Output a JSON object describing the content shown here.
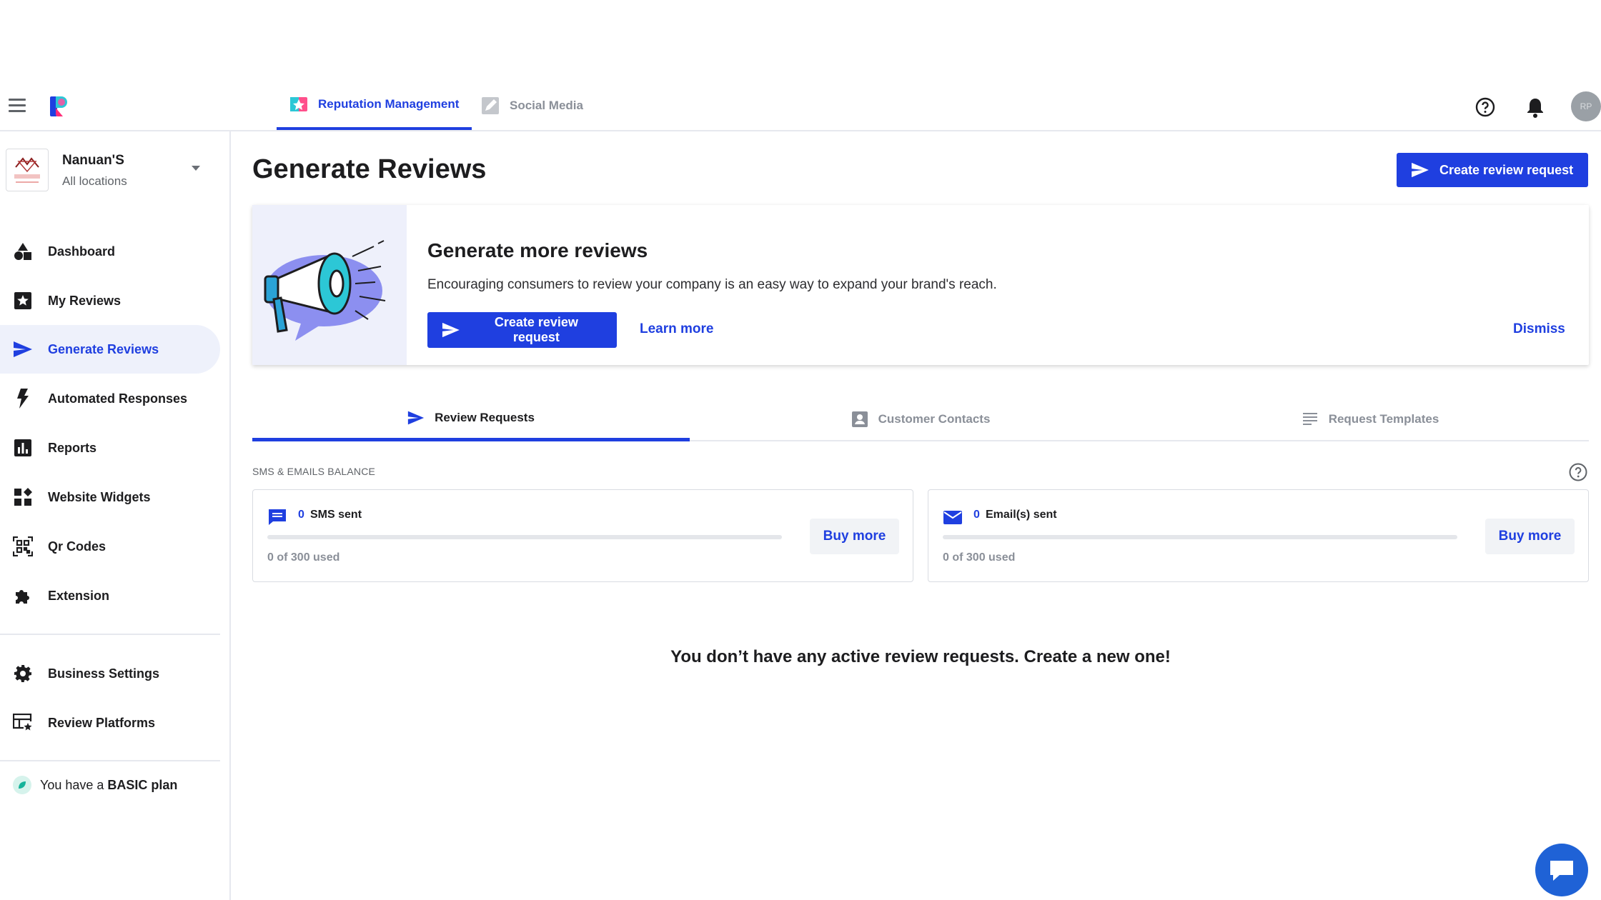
{
  "topbar": {
    "products": [
      {
        "label": "Reputation Management",
        "active": true,
        "icon": "star-flag-icon"
      },
      {
        "label": "Social Media",
        "active": false,
        "icon": "edit-icon"
      }
    ],
    "avatar_initials": "RP"
  },
  "business": {
    "name": "Nanuan'S",
    "locations": "All locations"
  },
  "sidebar": {
    "items": [
      {
        "label": "Dashboard",
        "icon": "shapes-icon"
      },
      {
        "label": "My Reviews",
        "icon": "star-box-icon"
      },
      {
        "label": "Generate Reviews",
        "icon": "send-icon",
        "active": true
      },
      {
        "label": "Automated Responses",
        "icon": "bolt-icon"
      },
      {
        "label": "Reports",
        "icon": "bar-chart-icon"
      },
      {
        "label": "Website Widgets",
        "icon": "widgets-icon"
      },
      {
        "label": "Qr Codes",
        "icon": "qr-code-icon"
      },
      {
        "label": "Extension",
        "icon": "puzzle-icon"
      }
    ],
    "secondary": [
      {
        "label": "Business Settings",
        "icon": "gear-icon"
      },
      {
        "label": "Review Platforms",
        "icon": "table-star-icon"
      }
    ],
    "plan_prefix": "You have a ",
    "plan_name": "BASIC plan"
  },
  "page": {
    "title": "Generate Reviews",
    "create_button": "Create review request"
  },
  "banner": {
    "title": "Generate more reviews",
    "text": "Encouraging consumers to review your company is an easy way to expand your brand's reach.",
    "create_button": "Create review request",
    "learn_more": "Learn more",
    "dismiss": "Dismiss"
  },
  "tabs": [
    {
      "label": "Review Requests",
      "active": true,
      "icon": "send-icon"
    },
    {
      "label": "Customer Contacts",
      "active": false,
      "icon": "contact-card-icon"
    },
    {
      "label": "Request Templates",
      "active": false,
      "icon": "lines-icon"
    }
  ],
  "balance": {
    "label": "SMS & EMAILS BALANCE",
    "cards": [
      {
        "count": "0",
        "label": "SMS sent",
        "used": "0 of 300 used",
        "fill": 0.0,
        "buy": "Buy more",
        "icon": "message-icon"
      },
      {
        "count": "0",
        "label": "Email(s) sent",
        "used": "0 of 300 used",
        "fill": 0.0,
        "buy": "Buy more",
        "icon": "envelope-icon"
      }
    ]
  },
  "empty_state": "You don’t have any active review requests. Create a new one!",
  "colors": {
    "accent": "#1f3fe0",
    "active_bg": "#eef1fb",
    "chat": "#1f62d6"
  }
}
